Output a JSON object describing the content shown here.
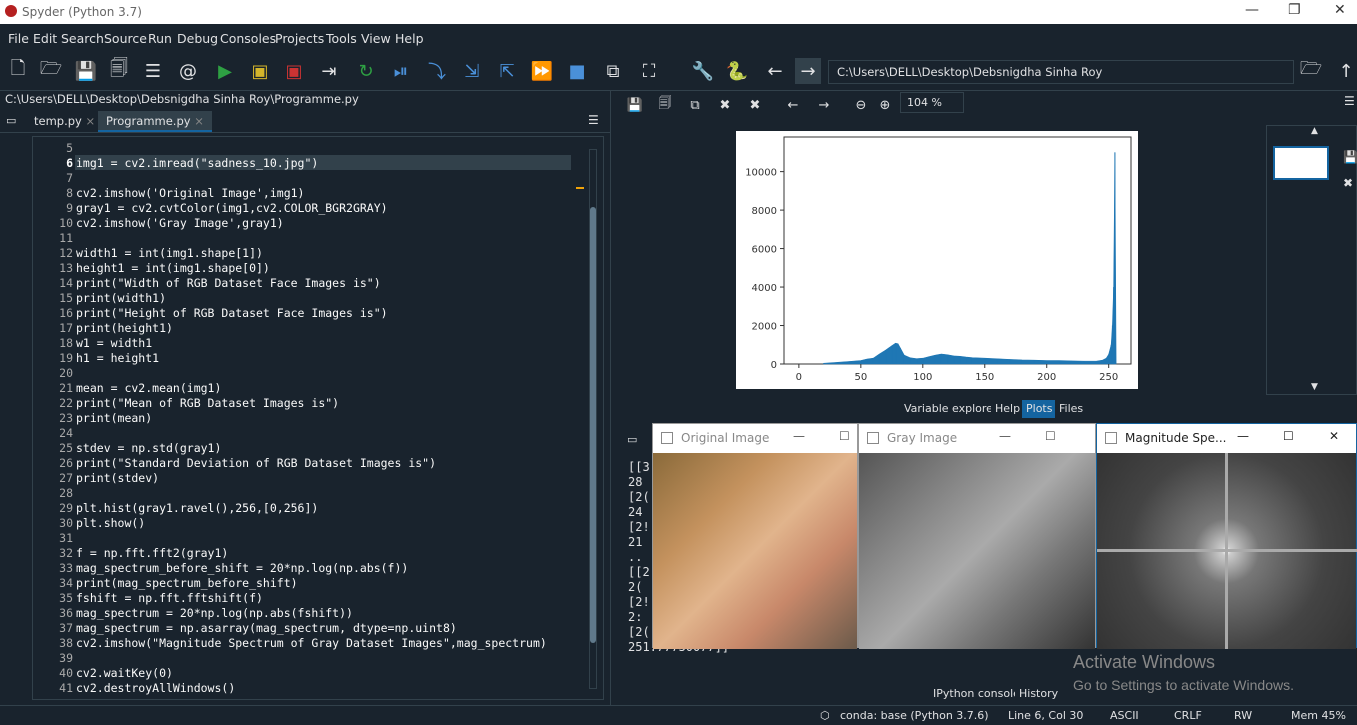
{
  "window": {
    "title": "Spyder (Python 3.7)",
    "minimize": "—",
    "restore": "❐",
    "close": "✕"
  },
  "menu": [
    "File",
    "Edit",
    "Search",
    "Source",
    "Run",
    "Debug",
    "Consoles",
    "Projects",
    "Tools",
    "View",
    "Help"
  ],
  "toolbar": {
    "path": "C:\\Users\\DELL\\Desktop\\Debsnigdha Sinha Roy"
  },
  "editor": {
    "filepath": "C:\\Users\\DELL\\Desktop\\Debsnigdha Sinha Roy\\Programme.py",
    "tabs": [
      {
        "label": "temp.py",
        "active": false
      },
      {
        "label": "Programme.py",
        "active": true
      }
    ],
    "lines": [
      {
        "n": "5",
        "code": ""
      },
      {
        "n": "6",
        "code": "img1 = cv2.imread(\"sadness_10.jpg\")"
      },
      {
        "n": "7",
        "code": ""
      },
      {
        "n": "8",
        "code": "cv2.imshow('Original Image',img1)"
      },
      {
        "n": "9",
        "code": "gray1 = cv2.cvtColor(img1,cv2.COLOR_BGR2GRAY)"
      },
      {
        "n": "10",
        "code": "cv2.imshow('Gray Image',gray1)"
      },
      {
        "n": "11",
        "code": ""
      },
      {
        "n": "12",
        "code": "width1 = int(img1.shape[1])"
      },
      {
        "n": "13",
        "code": "height1 = int(img1.shape[0])"
      },
      {
        "n": "14",
        "code": "print(\"Width of RGB Dataset Face Images is\")"
      },
      {
        "n": "15",
        "code": "print(width1)"
      },
      {
        "n": "16",
        "code": "print(\"Height of RGB Dataset Face Images is\")"
      },
      {
        "n": "17",
        "code": "print(height1)"
      },
      {
        "n": "18",
        "code": "w1 = width1"
      },
      {
        "n": "19",
        "code": "h1 = height1"
      },
      {
        "n": "20",
        "code": ""
      },
      {
        "n": "21",
        "code": "mean = cv2.mean(img1)"
      },
      {
        "n": "22",
        "code": "print(\"Mean of RGB Dataset Images is\")"
      },
      {
        "n": "23",
        "code": "print(mean)"
      },
      {
        "n": "24",
        "code": ""
      },
      {
        "n": "25",
        "code": "stdev = np.std(gray1)"
      },
      {
        "n": "26",
        "code": "print(\"Standard Deviation of RGB Dataset Images is\")"
      },
      {
        "n": "27",
        "code": "print(stdev)"
      },
      {
        "n": "28",
        "code": ""
      },
      {
        "n": "29",
        "code": "plt.hist(gray1.ravel(),256,[0,256])"
      },
      {
        "n": "30",
        "code": "plt.show()"
      },
      {
        "n": "31",
        "code": ""
      },
      {
        "n": "32",
        "code": "f = np.fft.fft2(gray1)"
      },
      {
        "n": "33",
        "code": "mag_spectrum_before_shift = 20*np.log(np.abs(f))"
      },
      {
        "n": "34",
        "code": "print(mag_spectrum_before_shift)"
      },
      {
        "n": "35",
        "code": "fshift = np.fft.fftshift(f)"
      },
      {
        "n": "36",
        "code": "mag_spectrum = 20*np.log(np.abs(fshift))"
      },
      {
        "n": "37",
        "code": "mag_spectrum = np.asarray(mag_spectrum, dtype=np.uint8)"
      },
      {
        "n": "38",
        "code": "cv2.imshow(\"Magnitude Spectrum of Gray Dataset Images\",mag_spectrum)"
      },
      {
        "n": "39",
        "code": ""
      },
      {
        "n": "40",
        "code": "cv2.waitKey(0)"
      },
      {
        "n": "41",
        "code": "cv2.destroyAllWindows()"
      }
    ]
  },
  "plots": {
    "zoom": "104 %",
    "tabs": [
      "Variable explorer",
      "Help",
      "Plots",
      "Files"
    ]
  },
  "chart_data": {
    "type": "bar",
    "x_ticks": [
      "0",
      "50",
      "100",
      "150",
      "200",
      "250"
    ],
    "y_ticks": [
      "0",
      "2000",
      "4000",
      "6000",
      "8000",
      "10000"
    ],
    "xlim": [
      -12,
      268
    ],
    "ylim": [
      0,
      11800
    ],
    "hist": [
      [
        20,
        40
      ],
      [
        30,
        80
      ],
      [
        40,
        130
      ],
      [
        50,
        180
      ],
      [
        55,
        260
      ],
      [
        60,
        300
      ],
      [
        65,
        520
      ],
      [
        70,
        720
      ],
      [
        75,
        950
      ],
      [
        78,
        1080
      ],
      [
        80,
        1050
      ],
      [
        82,
        820
      ],
      [
        85,
        460
      ],
      [
        90,
        320
      ],
      [
        95,
        280
      ],
      [
        100,
        300
      ],
      [
        105,
        380
      ],
      [
        110,
        460
      ],
      [
        115,
        520
      ],
      [
        120,
        480
      ],
      [
        125,
        420
      ],
      [
        130,
        400
      ],
      [
        135,
        360
      ],
      [
        140,
        330
      ],
      [
        150,
        300
      ],
      [
        160,
        270
      ],
      [
        170,
        240
      ],
      [
        180,
        210
      ],
      [
        190,
        200
      ],
      [
        200,
        180
      ],
      [
        210,
        180
      ],
      [
        220,
        160
      ],
      [
        230,
        150
      ],
      [
        240,
        150
      ],
      [
        245,
        200
      ],
      [
        248,
        300
      ],
      [
        250,
        500
      ],
      [
        252,
        1000
      ],
      [
        253,
        2000
      ],
      [
        254,
        4000
      ],
      [
        255,
        11000
      ]
    ]
  },
  "windows": {
    "original": {
      "title": "Original Image"
    },
    "gray": {
      "title": "Gray Image"
    },
    "magnitude": {
      "title": "Magnitude Spe..."
    }
  },
  "console": {
    "tabs": [
      "IPython console",
      "History"
    ],
    "lines": [
      "[[3",
      "  28",
      "[2(",
      "  24",
      "[2!",
      "  21",
      "..",
      "[[2",
      "  2(",
      "[2!",
      "  2:",
      "[2(",
      "  251.77750077]]"
    ]
  },
  "watermark": {
    "title": "Activate Windows",
    "subtitle": "Go to Settings to activate Windows."
  },
  "status": {
    "env": "conda: base (Python 3.7.6)",
    "pos": "Line 6, Col 30",
    "enc": "ASCII",
    "eol": "CRLF",
    "rw": "RW",
    "mem": "Mem 45%"
  }
}
